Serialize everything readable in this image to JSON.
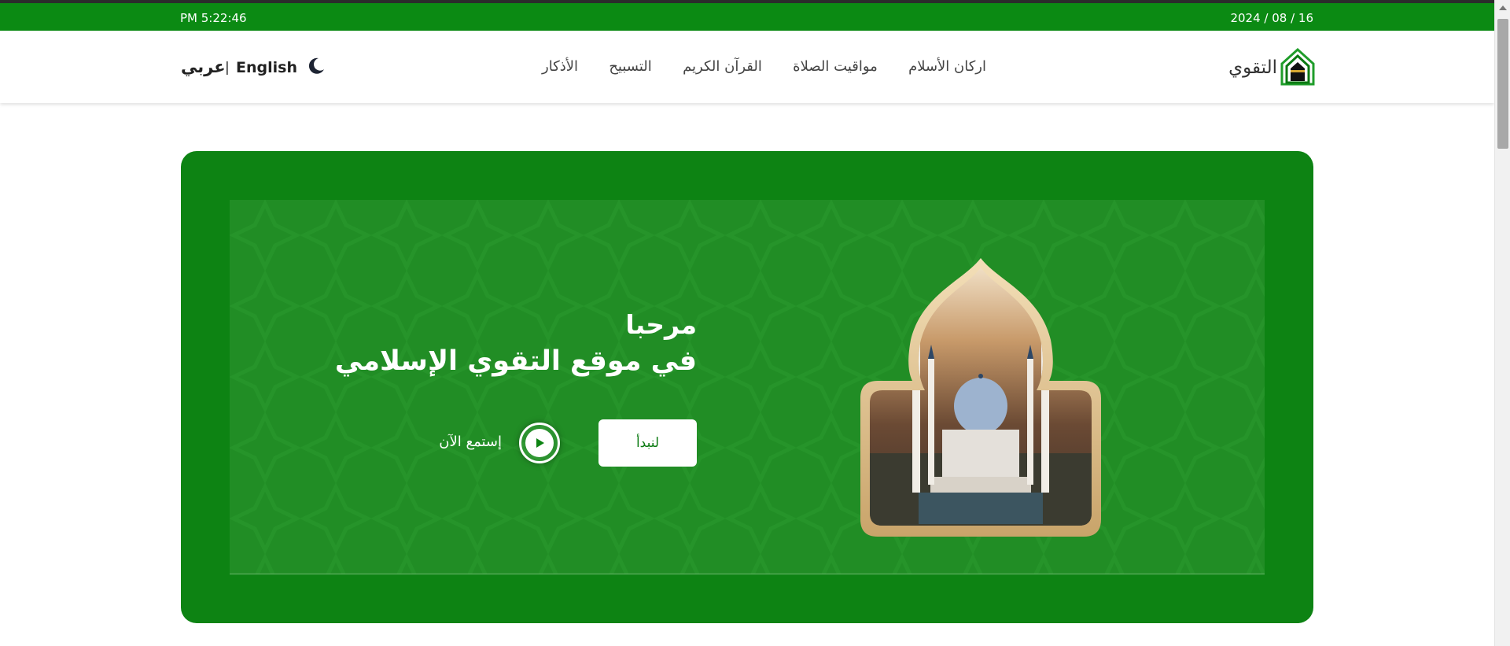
{
  "topbar": {
    "time": "PM 5:22:46",
    "date": "2024 / 08 / 16",
    "bg_color": "#0b8a13"
  },
  "header": {
    "logo_icon": "mosque-logo-icon",
    "site_name": "التقوي",
    "nav": [
      {
        "label": "اركان الأسلام"
      },
      {
        "label": "مواقيت الصلاة"
      },
      {
        "label": "القرآن الكريم"
      },
      {
        "label": "التسبيح"
      },
      {
        "label": "الأذكار"
      }
    ],
    "theme_toggle_icon": "moon-icon",
    "lang_en": "English",
    "lang_separator": "|",
    "lang_ar": "عربي"
  },
  "hero": {
    "title_line1": "مرحبا",
    "title_line2": "في موقع التقوي الإسلامي",
    "start_button": "لنبدأ",
    "listen_label": "إستمع الآن",
    "play_icon": "play-icon",
    "image": "mosque-image",
    "bg_color": "#0d8313",
    "inner_color": "#218d25"
  }
}
